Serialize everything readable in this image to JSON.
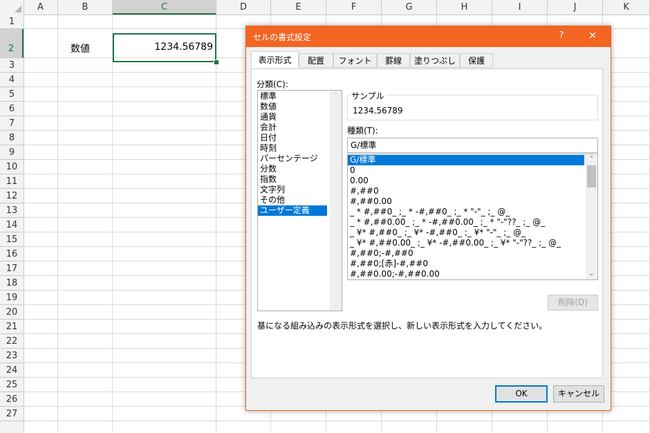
{
  "sheet": {
    "columns": [
      "A",
      "B",
      "C",
      "D",
      "E",
      "F",
      "G",
      "H",
      "I",
      "J",
      "K"
    ],
    "rows": [
      "1",
      "2",
      "3",
      "4",
      "5",
      "6",
      "7",
      "8",
      "9",
      "10",
      "11",
      "12",
      "13",
      "14",
      "15",
      "16",
      "17",
      "18",
      "19",
      "20",
      "21",
      "22",
      "23",
      "24",
      "25",
      "26",
      "27"
    ],
    "selected_column": "C",
    "selected_row": "2",
    "cell_b2": "数値",
    "cell_c2": "1234.56789"
  },
  "dialog": {
    "title": "セルの書式設定",
    "help_label": "?",
    "close_label": "✕",
    "tabs": [
      "表示形式",
      "配置",
      "フォント",
      "罫線",
      "塗りつぶし",
      "保護"
    ],
    "active_tab": "表示形式",
    "category_label": "分類(C):",
    "categories": [
      "標準",
      "数値",
      "通貨",
      "会計",
      "日付",
      "時刻",
      "パーセンテージ",
      "分数",
      "指数",
      "文字列",
      "その他",
      "ユーザー定義"
    ],
    "selected_category": "ユーザー定義",
    "sample_label": "サンプル",
    "sample_value": "1234.56789",
    "type_label": "種類(T):",
    "type_value": "G/標準",
    "formats": [
      "G/標準",
      "0",
      "0.00",
      "#,##0",
      "#,##0.00",
      "_ * #,##0_ ;_ * -#,##0_ ;_ * \"-\"_ ;_ @_",
      "_ * #,##0.00_ ;_ * -#,##0.00_ ;_ * \"-\"??_ ;_ @_",
      "_ ¥* #,##0_ ;_ ¥* -#,##0_ ;_ ¥* \"-\"_ ;_ @_",
      "_ ¥* #,##0.00_ ;_ ¥* -#,##0.00_ ;_ ¥* \"-\"??_ ;_ @_",
      "#,##0;-#,##0",
      "#,##0;[赤]-#,##0",
      "#,##0.00;-#,##0.00"
    ],
    "selected_format": "G/標準",
    "delete_label": "削除(D)",
    "description": "基になる組み込みの表示形式を選択し、新しい表示形式を入力してください。",
    "ok_label": "OK",
    "cancel_label": "キャンセル"
  },
  "colors": {
    "excel_green": "#217346",
    "titlebar_orange": "#f26522",
    "selection_blue": "#0078d7"
  }
}
